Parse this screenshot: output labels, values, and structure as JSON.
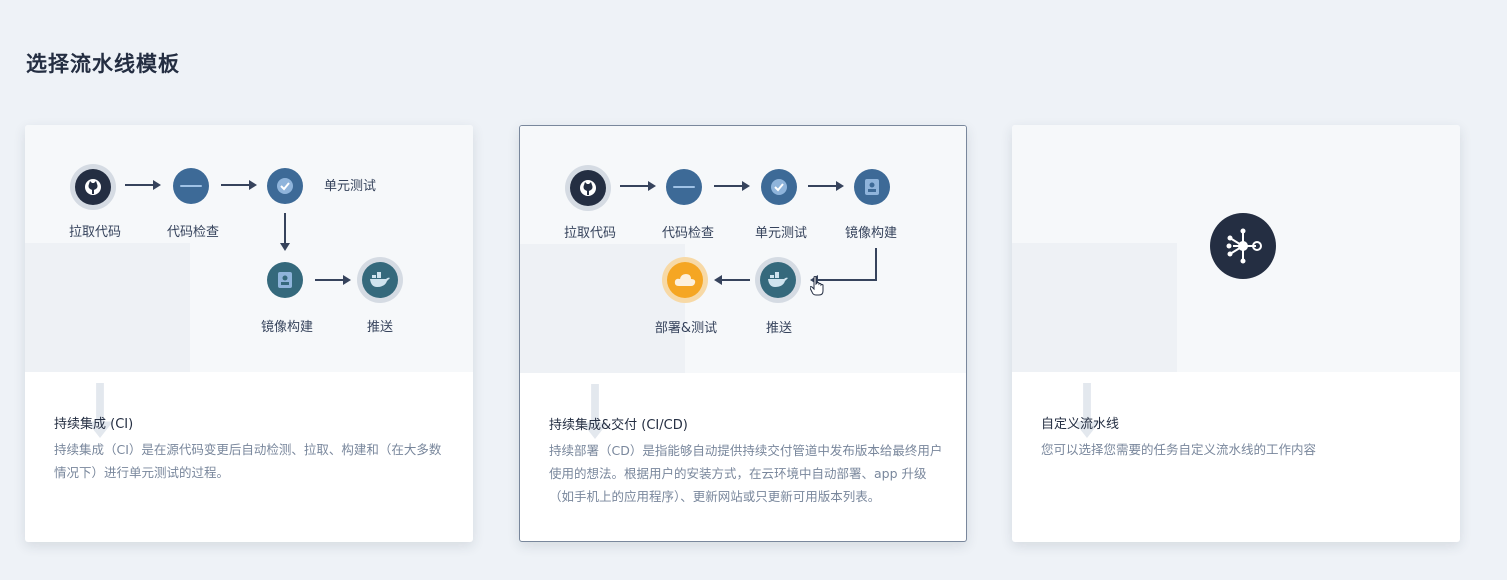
{
  "page": {
    "title": "选择流水线模板"
  },
  "cards": {
    "ci": {
      "steps": {
        "pull": "拉取代码",
        "check": "代码检查",
        "unittest": "单元测试",
        "build": "镜像构建",
        "push": "推送"
      },
      "title": "持续集成 (CI)",
      "description": "持续集成（CI）是在源代码变更后自动检测、拉取、构建和（在大多数情况下）进行单元测试的过程。"
    },
    "cicd": {
      "selected": true,
      "steps": {
        "pull": "拉取代码",
        "check": "代码检查",
        "unittest": "单元测试",
        "build": "镜像构建",
        "push": "推送",
        "deploy": "部署&测试"
      },
      "title": "持续集成&交付 (CI/CD)",
      "description": "持续部署（CD）是指能够自动提供持续交付管道中发布版本给最终用户使用的想法。根据用户的安装方式，在云环境中自动部署、app 升级（如手机上的应用程序）、更新网站或只更新可用版本列表。"
    },
    "custom": {
      "title": "自定义流水线",
      "description": "您可以选择您需要的任务自定义流水线的工作内容"
    }
  },
  "icons": {
    "pull": "github-icon",
    "check": "sonarqube-icon",
    "unittest": "check-icon",
    "build": "container-image-icon",
    "push": "docker-icon",
    "deploy": "cloud-icon",
    "custom": "pipeline-network-icon",
    "pointer": "hand-cursor-icon"
  },
  "colors": {
    "background": "#eef2f7",
    "node_dark": "#242e42",
    "node_blue": "#3d6a97",
    "node_teal": "#35697c",
    "node_orange": "#f5a623",
    "text_muted": "#79879c"
  }
}
